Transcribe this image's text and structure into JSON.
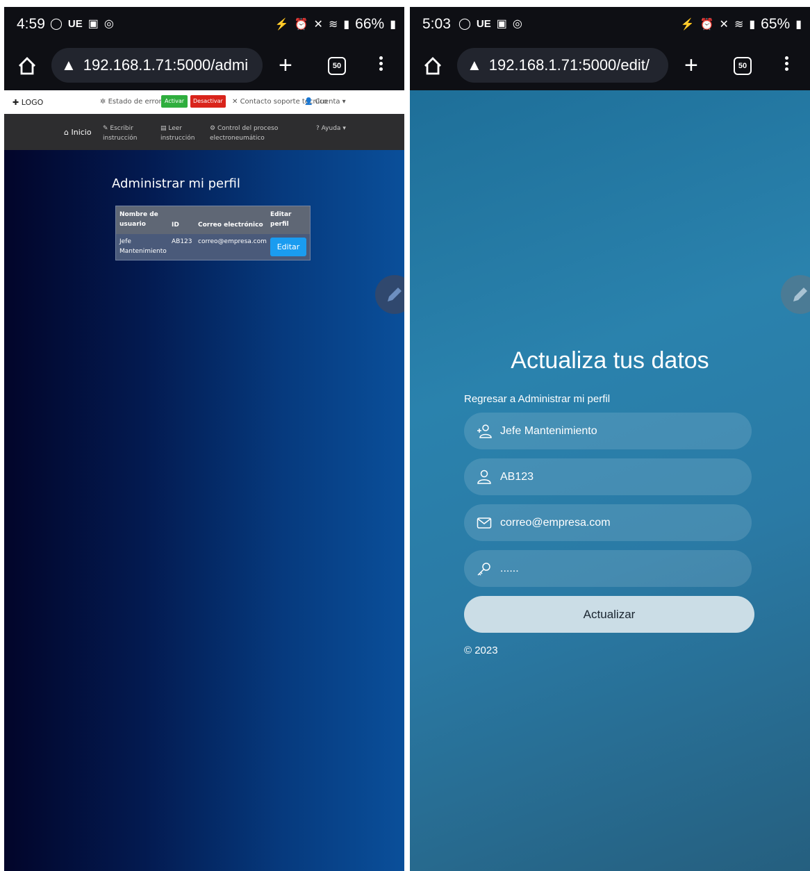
{
  "left": {
    "status": {
      "time": "4:59",
      "carrier": "UE",
      "battery": "66%"
    },
    "browser": {
      "url": "192.168.1.71:5000/admi",
      "tab_count": "50"
    },
    "topnav": {
      "logo": "LOGO",
      "estado_label": "Estado de error:",
      "activar": "Activar",
      "desactivar": "Desactivar",
      "contacto": "Contacto soporte técnico",
      "cuenta": "Cuenta"
    },
    "mainnav": {
      "inicio": "Inicio",
      "escribir_1": "Escribir",
      "escribir_2": "instrucción",
      "leer_1": "Leer",
      "leer_2": "instrucción",
      "control_1": "Control del proceso",
      "control_2": "electroneumático",
      "ayuda": "? Ayuda"
    },
    "page_title": "Administrar mi perfil",
    "table": {
      "headers": {
        "usuario_1": "Nombre de",
        "usuario_2": "usuario",
        "id": "ID",
        "correo": "Correo electrónico",
        "editar_1": "Editar",
        "editar_2": "perfil"
      },
      "rows": [
        {
          "usuario_1": "Jefe",
          "usuario_2": "Mantenimiento",
          "id": "AB123",
          "correo": "correo@empresa.com",
          "action": "Editar"
        }
      ]
    }
  },
  "right": {
    "status": {
      "time": "5:03",
      "carrier": "UE",
      "battery": "65%"
    },
    "browser": {
      "url": "192.168.1.71:5000/edit/",
      "tab_count": "50"
    },
    "form": {
      "title": "Actualiza tus datos",
      "back_link": "Regresar a Administrar mi perfil",
      "username": "Jefe Mantenimiento",
      "id": "AB123",
      "email": "correo@empresa.com",
      "password": "......",
      "submit": "Actualizar",
      "copyright": "© 2023"
    }
  },
  "icons": {
    "home": "home-icon",
    "warning": "warning-icon",
    "plus": "plus-icon",
    "tabs": "tabs-icon",
    "menu": "more-vert-icon",
    "pencil": "pencil-icon",
    "user-add": "user-add-icon",
    "user": "user-icon",
    "mail": "mail-icon",
    "key": "key-icon"
  }
}
